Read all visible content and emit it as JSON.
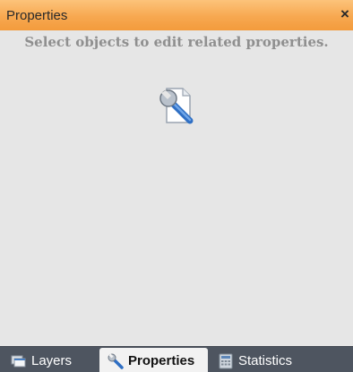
{
  "panel": {
    "title": "Properties",
    "close_glyph": "×",
    "hint": "Select objects to edit related properties.",
    "empty_icon": "wrench-document-icon"
  },
  "tabs": [
    {
      "label": "Layers",
      "icon": "layers-icon",
      "active": false
    },
    {
      "label": "Properties",
      "icon": "wrench-icon",
      "active": true
    },
    {
      "label": "Statistics",
      "icon": "calculator-icon",
      "active": false
    }
  ],
  "colors": {
    "title_bar": "#f7a850",
    "panel_background": "#e6e6e6",
    "tab_strip": "#4e5560",
    "active_tab": "#f2f2f2",
    "hint_text": "#8f8f8f"
  }
}
